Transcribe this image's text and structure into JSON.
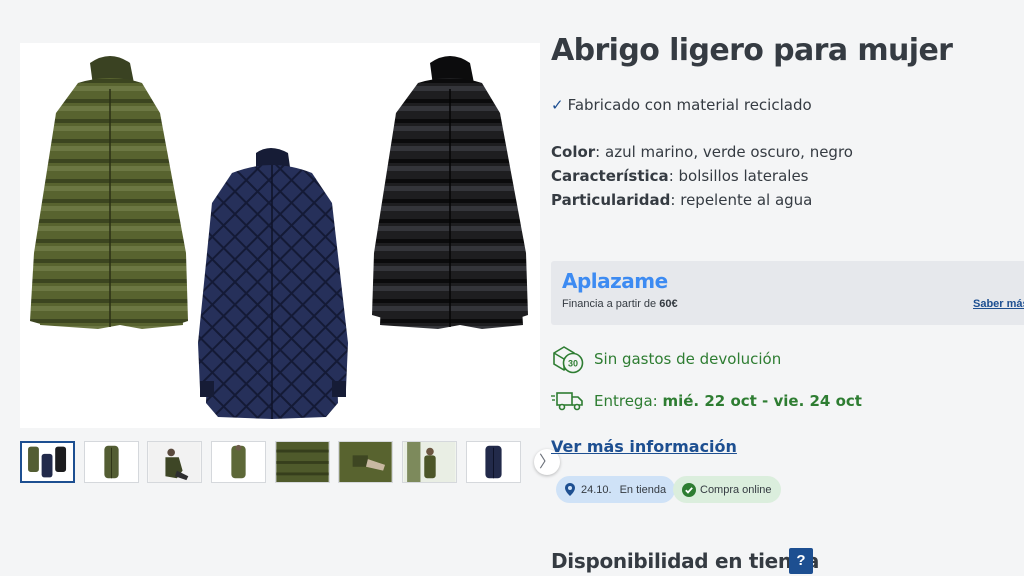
{
  "product": {
    "title": "Abrigo ligero para mujer",
    "feature": "Fabricado con material reciclado",
    "specs": [
      {
        "label": "Color",
        "value": "azul marino, verde oscuro, negro"
      },
      {
        "label": "Característica",
        "value": "bolsillos laterales"
      },
      {
        "label": "Particularidad",
        "value": "repelente al agua"
      }
    ]
  },
  "financing": {
    "brand": "Aplazame",
    "text": "Financia a partir de",
    "amount": "60€",
    "link": "Saber más"
  },
  "returns": {
    "icon_label": "30",
    "text": "Sin gastos de devolución"
  },
  "delivery": {
    "label": "Entrega:",
    "dates": "mié. 22 oct - vie. 24 oct"
  },
  "more_info_link": "Ver más información",
  "badges": {
    "store_date": "24.10.",
    "store_text": "En tienda",
    "online_text": "Compra online"
  },
  "availability": {
    "title": "Disponibilidad en tienda",
    "help": "?"
  },
  "thumbnails": {
    "next_arrow": "〉",
    "selected_index": 0
  },
  "colors": {
    "accent_blue": "#1d4f91",
    "green": "#2e7d32",
    "aplazame": "#3d8bf2",
    "olive_coat": "#535d33",
    "navy_coat": "#222a4a",
    "black_coat": "#1c1c1e"
  },
  "icons": [
    "checkmark-icon",
    "return-box-icon",
    "delivery-truck-icon",
    "location-pin-icon",
    "check-circle-icon",
    "chevron-right-icon"
  ]
}
